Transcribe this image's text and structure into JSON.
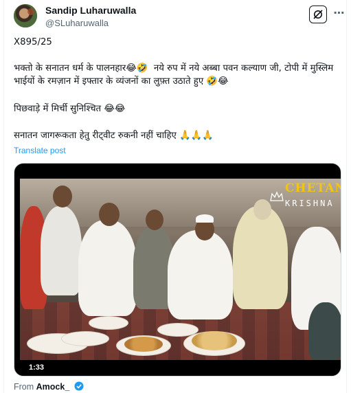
{
  "author": {
    "name": "Sandip Luharuwalla",
    "handle": "@SLuharuwalla"
  },
  "post": {
    "line1": "X895/25",
    "line2": "भक्तो के सनातन धर्म के पालनहार😂🤣  नये रुप में नये अब्बा पवन कल्याण जी, टोपी में मुस्लिम भाईयों के रमज़ान में इफ्तार के व्यंजनों का लुफ़्त उठाते हुए 🤣😂",
    "line3": "पिछवाड़े में मिर्ची सुनिश्चित 😂😂",
    "line4": "सनातन जागरूकता हेतु रीट्वीट रुकनी नहीं चाहिए 🙏🙏🙏",
    "translate": "Translate post"
  },
  "media": {
    "logo_top": "CHETAN",
    "logo_bottom": "KRISHNA",
    "duration": "1:33"
  },
  "source": {
    "prefix": "From",
    "account": "Amock_"
  },
  "colors": {
    "accent": "#1d9bf0",
    "text_secondary": "#536471",
    "logo_gold": "#f0c419"
  },
  "icons": [
    "grok-icon",
    "more-icon",
    "crown-icon",
    "verified-badge-icon"
  ]
}
